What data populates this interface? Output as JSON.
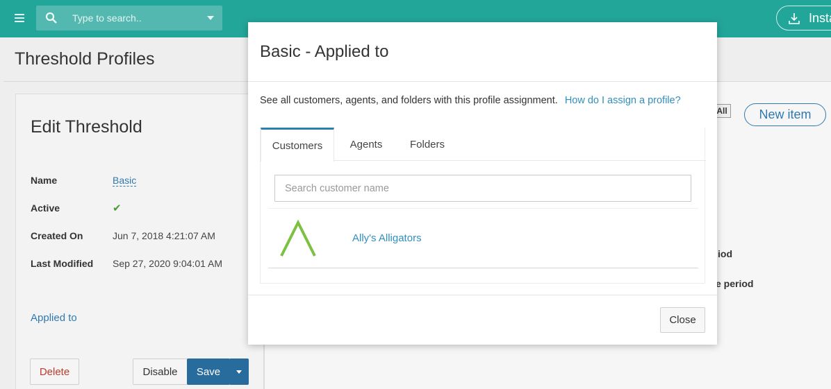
{
  "topbar": {
    "search_placeholder": "Type to search..",
    "install_label": "Insta",
    "icons": [
      "menu-icon",
      "search-icon",
      "dropdown-caret-icon",
      "download-icon"
    ],
    "color": "#23a69a"
  },
  "page": {
    "title": "Threshold Profiles",
    "edit_card": {
      "title": "Edit Threshold",
      "fields": [
        {
          "label": "Name",
          "value": "Basic"
        },
        {
          "label": "Active",
          "value": "✔"
        },
        {
          "label": "Created On",
          "value": "Jun 7, 2018 4:21:07 AM"
        },
        {
          "label": "Last Modified",
          "value": "Sep 27, 2020 9:04:01 AM"
        }
      ],
      "applied_link": "Applied to",
      "buttons": {
        "delete": "Delete",
        "disable": "Disable",
        "save": "Save"
      }
    },
    "right_panel": {
      "all_badge": "All",
      "new_item": "New item",
      "fragment_1": "iod",
      "fragment_2": "e period"
    }
  },
  "modal": {
    "title": "Basic - Applied to",
    "description": "See all customers, agents, and folders with this profile assignment.",
    "help_link": "How do I assign a profile?",
    "tabs": [
      {
        "label": "Customers",
        "active": true
      },
      {
        "label": "Agents",
        "active": false
      },
      {
        "label": "Folders",
        "active": false
      }
    ],
    "search_placeholder": "Search customer name",
    "customers": [
      {
        "name": "Ally's Alligators",
        "logo": "caret-up-logo"
      }
    ],
    "close_label": "Close"
  }
}
